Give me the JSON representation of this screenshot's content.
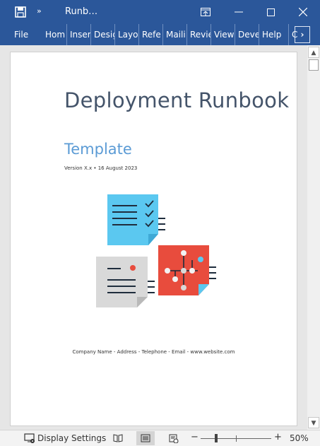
{
  "titlebar": {
    "doc_title": "Runb…",
    "qat_more": "»",
    "restore_symbol": "⊡",
    "minimize_symbol": "—",
    "maximize_symbol": "☐",
    "close_symbol": "✕"
  },
  "ribbon": {
    "tabs": [
      "File",
      "Hom",
      "Inser",
      "Desig",
      "Layo",
      "Refe",
      "Maili",
      "Revie",
      "View",
      "Deve",
      "Help",
      "C"
    ],
    "more_symbol": "›"
  },
  "document": {
    "title": "Deployment Runbook",
    "subtitle": "Template",
    "version_line": "Version X.x • 16 August 2023",
    "footer": "Company Name - Address - Telephone - Email - www.website.com"
  },
  "statusbar": {
    "display_settings": "Display Settings",
    "zoom_minus": "−",
    "zoom_plus": "+",
    "zoom_percent": 50,
    "zoom_label": "50%"
  },
  "scrollbar": {
    "up_symbol": "▲",
    "down_symbol": "▼"
  },
  "colors": {
    "title_bar": "#2b579a",
    "doc_title": "#44546a",
    "doc_subtitle": "#5b9bd5",
    "note_blue": "#5bc8f0",
    "note_red": "#e84c3d",
    "note_gray": "#d9d9d9"
  },
  "icons": [
    "save-icon",
    "quick-access-more-icon",
    "ribbon-display-icon",
    "minimize-icon",
    "maximize-icon",
    "close-icon",
    "display-settings-icon",
    "read-mode-icon",
    "print-layout-icon",
    "web-layout-icon"
  ]
}
